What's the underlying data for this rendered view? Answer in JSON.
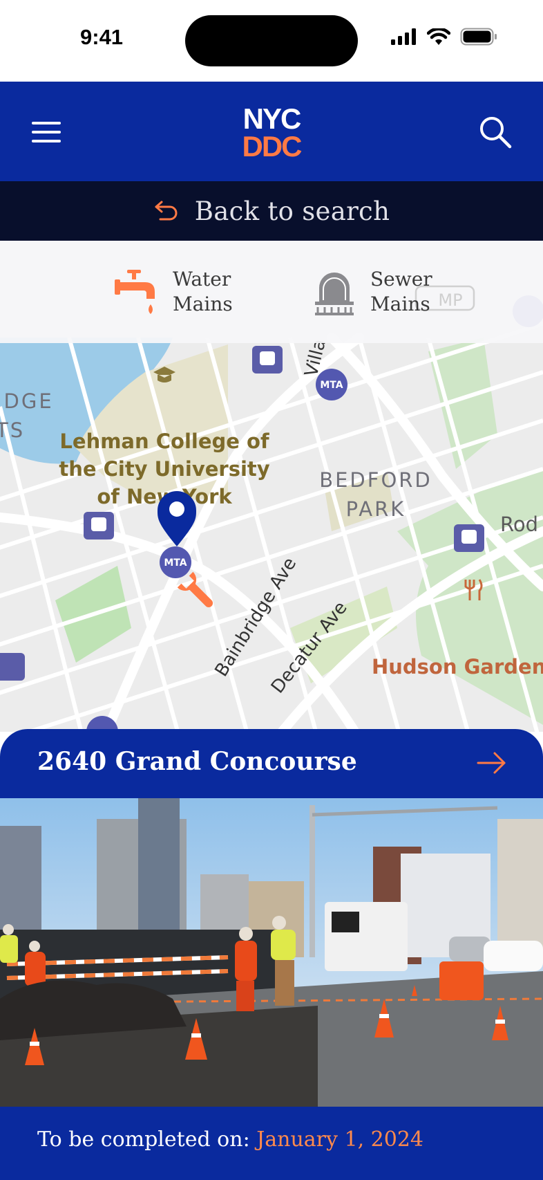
{
  "status_bar": {
    "time": "9:41"
  },
  "header": {
    "logo_text_top": "NYC",
    "logo_text_bottom": "DDC"
  },
  "back_bar": {
    "label": "Back to search"
  },
  "legend": {
    "items": [
      {
        "label_line1": "Water",
        "label_line2": "Mains",
        "icon": "water-tap-icon"
      },
      {
        "label_line1": "Sewer",
        "label_line2": "Mains",
        "icon": "sewer-manhole-icon"
      }
    ]
  },
  "map": {
    "labels": {
      "college_1": "Lehman College of",
      "college_2": "the City University",
      "college_3": "of New York",
      "park_1": "BEDFORD",
      "park_2": "PARK",
      "edge_left_1": "IDGE",
      "edge_left_2": "TS",
      "street_bainbridge": "Bainbridge Ave",
      "street_decatur": "Decatur Ave",
      "street_villa": "Villa",
      "garden": "Hudson Garden G",
      "rod": "Rod",
      "mp": "MP",
      "mta": "MTA"
    }
  },
  "project_card": {
    "address": "2640 Grand Concourse"
  },
  "footer": {
    "label": "To be completed on:",
    "date": "January 1, 2024"
  },
  "colors": {
    "brand_blue": "#0a2a9e",
    "accent_orange": "#ff7a45",
    "back_bar": "#080f2c"
  }
}
